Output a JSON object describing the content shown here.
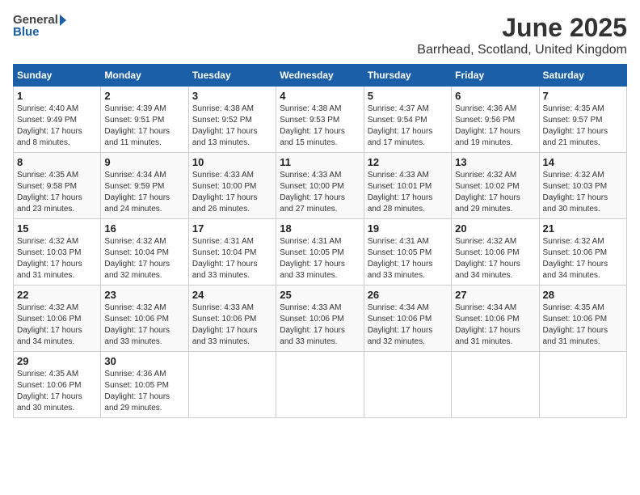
{
  "header": {
    "logo_general": "General",
    "logo_blue": "Blue",
    "month_year": "June 2025",
    "location": "Barrhead, Scotland, United Kingdom"
  },
  "days_of_week": [
    "Sunday",
    "Monday",
    "Tuesday",
    "Wednesday",
    "Thursday",
    "Friday",
    "Saturday"
  ],
  "weeks": [
    [
      {
        "day": 1,
        "info": "Sunrise: 4:40 AM\nSunset: 9:49 PM\nDaylight: 17 hours\nand 8 minutes."
      },
      {
        "day": 2,
        "info": "Sunrise: 4:39 AM\nSunset: 9:51 PM\nDaylight: 17 hours\nand 11 minutes."
      },
      {
        "day": 3,
        "info": "Sunrise: 4:38 AM\nSunset: 9:52 PM\nDaylight: 17 hours\nand 13 minutes."
      },
      {
        "day": 4,
        "info": "Sunrise: 4:38 AM\nSunset: 9:53 PM\nDaylight: 17 hours\nand 15 minutes."
      },
      {
        "day": 5,
        "info": "Sunrise: 4:37 AM\nSunset: 9:54 PM\nDaylight: 17 hours\nand 17 minutes."
      },
      {
        "day": 6,
        "info": "Sunrise: 4:36 AM\nSunset: 9:56 PM\nDaylight: 17 hours\nand 19 minutes."
      },
      {
        "day": 7,
        "info": "Sunrise: 4:35 AM\nSunset: 9:57 PM\nDaylight: 17 hours\nand 21 minutes."
      }
    ],
    [
      {
        "day": 8,
        "info": "Sunrise: 4:35 AM\nSunset: 9:58 PM\nDaylight: 17 hours\nand 23 minutes."
      },
      {
        "day": 9,
        "info": "Sunrise: 4:34 AM\nSunset: 9:59 PM\nDaylight: 17 hours\nand 24 minutes."
      },
      {
        "day": 10,
        "info": "Sunrise: 4:33 AM\nSunset: 10:00 PM\nDaylight: 17 hours\nand 26 minutes."
      },
      {
        "day": 11,
        "info": "Sunrise: 4:33 AM\nSunset: 10:00 PM\nDaylight: 17 hours\nand 27 minutes."
      },
      {
        "day": 12,
        "info": "Sunrise: 4:33 AM\nSunset: 10:01 PM\nDaylight: 17 hours\nand 28 minutes."
      },
      {
        "day": 13,
        "info": "Sunrise: 4:32 AM\nSunset: 10:02 PM\nDaylight: 17 hours\nand 29 minutes."
      },
      {
        "day": 14,
        "info": "Sunrise: 4:32 AM\nSunset: 10:03 PM\nDaylight: 17 hours\nand 30 minutes."
      }
    ],
    [
      {
        "day": 15,
        "info": "Sunrise: 4:32 AM\nSunset: 10:03 PM\nDaylight: 17 hours\nand 31 minutes."
      },
      {
        "day": 16,
        "info": "Sunrise: 4:32 AM\nSunset: 10:04 PM\nDaylight: 17 hours\nand 32 minutes."
      },
      {
        "day": 17,
        "info": "Sunrise: 4:31 AM\nSunset: 10:04 PM\nDaylight: 17 hours\nand 33 minutes."
      },
      {
        "day": 18,
        "info": "Sunrise: 4:31 AM\nSunset: 10:05 PM\nDaylight: 17 hours\nand 33 minutes."
      },
      {
        "day": 19,
        "info": "Sunrise: 4:31 AM\nSunset: 10:05 PM\nDaylight: 17 hours\nand 33 minutes."
      },
      {
        "day": 20,
        "info": "Sunrise: 4:32 AM\nSunset: 10:06 PM\nDaylight: 17 hours\nand 34 minutes."
      },
      {
        "day": 21,
        "info": "Sunrise: 4:32 AM\nSunset: 10:06 PM\nDaylight: 17 hours\nand 34 minutes."
      }
    ],
    [
      {
        "day": 22,
        "info": "Sunrise: 4:32 AM\nSunset: 10:06 PM\nDaylight: 17 hours\nand 34 minutes."
      },
      {
        "day": 23,
        "info": "Sunrise: 4:32 AM\nSunset: 10:06 PM\nDaylight: 17 hours\nand 33 minutes."
      },
      {
        "day": 24,
        "info": "Sunrise: 4:33 AM\nSunset: 10:06 PM\nDaylight: 17 hours\nand 33 minutes."
      },
      {
        "day": 25,
        "info": "Sunrise: 4:33 AM\nSunset: 10:06 PM\nDaylight: 17 hours\nand 33 minutes."
      },
      {
        "day": 26,
        "info": "Sunrise: 4:34 AM\nSunset: 10:06 PM\nDaylight: 17 hours\nand 32 minutes."
      },
      {
        "day": 27,
        "info": "Sunrise: 4:34 AM\nSunset: 10:06 PM\nDaylight: 17 hours\nand 31 minutes."
      },
      {
        "day": 28,
        "info": "Sunrise: 4:35 AM\nSunset: 10:06 PM\nDaylight: 17 hours\nand 31 minutes."
      }
    ],
    [
      {
        "day": 29,
        "info": "Sunrise: 4:35 AM\nSunset: 10:06 PM\nDaylight: 17 hours\nand 30 minutes."
      },
      {
        "day": 30,
        "info": "Sunrise: 4:36 AM\nSunset: 10:05 PM\nDaylight: 17 hours\nand 29 minutes."
      },
      null,
      null,
      null,
      null,
      null
    ]
  ]
}
